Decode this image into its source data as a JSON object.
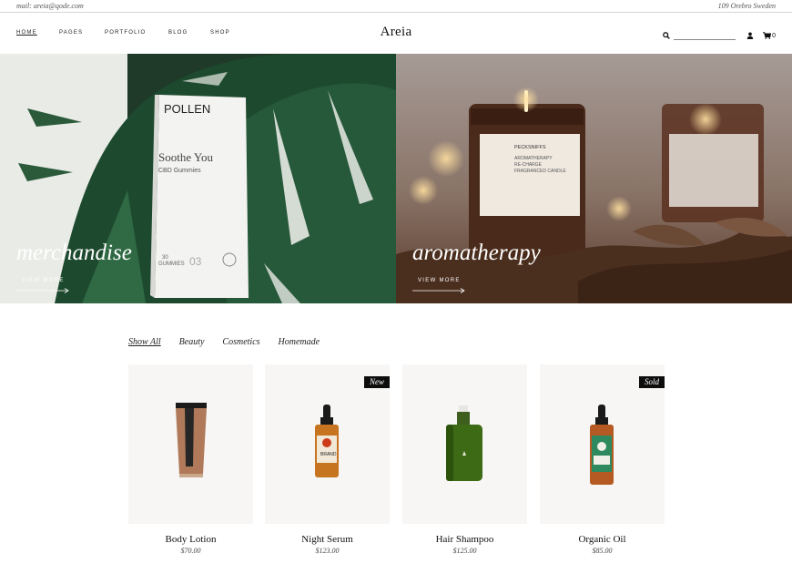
{
  "topbar": {
    "email": "mail: areia@qode.com",
    "address": "109 Orebro Sweden"
  },
  "header": {
    "logo": "Areia",
    "nav": [
      "Home",
      "Pages",
      "Portfolio",
      "Blog",
      "Shop"
    ],
    "cart_count": "0"
  },
  "hero": [
    {
      "title": "merchandise",
      "link": "View More"
    },
    {
      "title": "aromatherapy",
      "link": "View More"
    }
  ],
  "filters": [
    "Show All",
    "Beauty",
    "Cosmetics",
    "Homemade"
  ],
  "products": [
    {
      "name": "Body Lotion",
      "price": "$70.00",
      "badge": ""
    },
    {
      "name": "Night Serum",
      "price": "$123.00",
      "badge": "New"
    },
    {
      "name": "Hair Shampoo",
      "price": "$125.00",
      "badge": ""
    },
    {
      "name": "Organic Oil",
      "price": "$85.00",
      "badge": "Sold"
    }
  ],
  "colors": {
    "badge_bg": "#0d0d0d",
    "card_bg": "#f7f6f4"
  }
}
